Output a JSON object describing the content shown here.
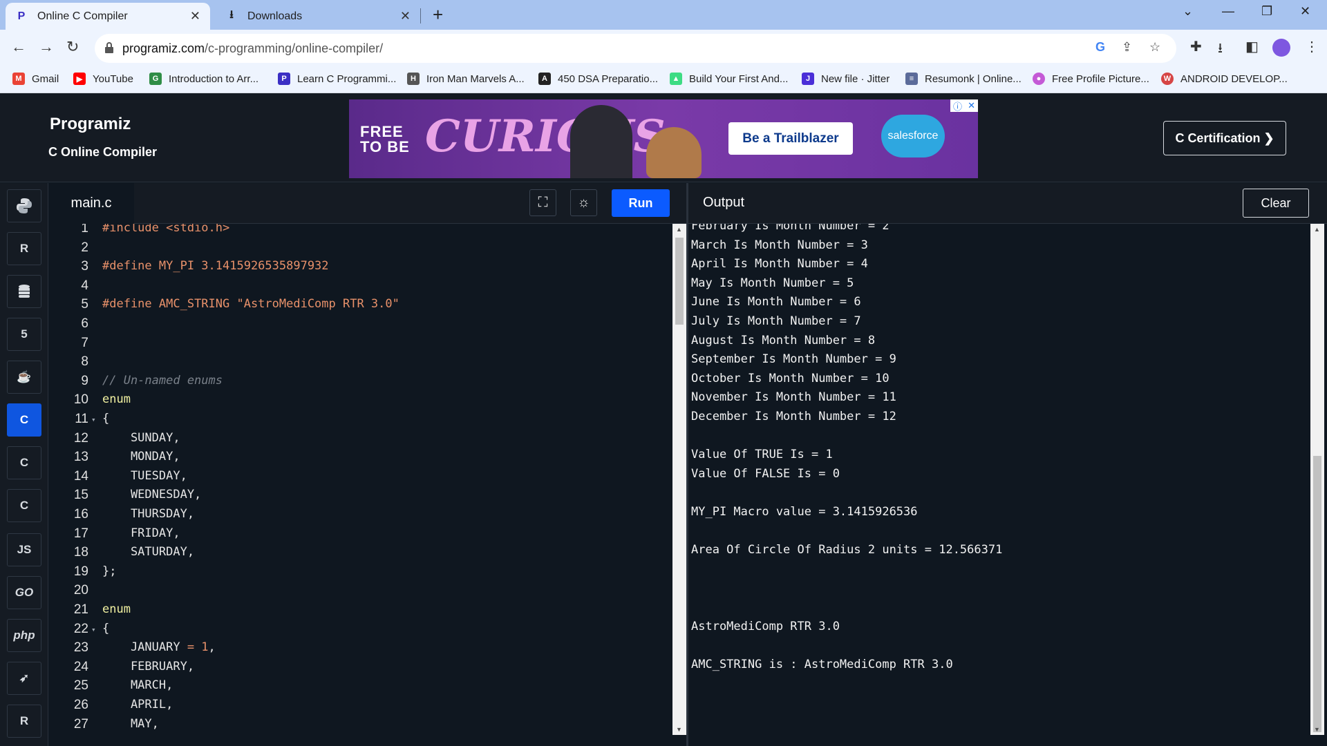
{
  "browser": {
    "tabs": [
      {
        "title": "Online C Compiler",
        "icon": "programiz-icon",
        "active": true
      },
      {
        "title": "Downloads",
        "icon": "download-icon",
        "active": false
      }
    ],
    "url_host": "programiz.com",
    "url_path": "/c-programming/online-compiler/",
    "bookmarks": [
      {
        "label": "Gmail",
        "icon": "gmail-icon",
        "color": "#ea4335"
      },
      {
        "label": "YouTube",
        "icon": "youtube-icon",
        "color": "#ff0000"
      },
      {
        "label": "Introduction to Arr...",
        "icon": "gfg-icon",
        "color": "#2f8d46"
      },
      {
        "label": "Learn C Programmi...",
        "icon": "programiz-icon",
        "color": "#3b2fc4"
      },
      {
        "label": "Iron Man Marvels A...",
        "icon": "hd-icon",
        "color": "#555555"
      },
      {
        "label": "450 DSA Preparatio...",
        "icon": "angular-icon",
        "color": "#222222"
      },
      {
        "label": "Build Your First And...",
        "icon": "android-icon",
        "color": "#3ddc84"
      },
      {
        "label": "New file · Jitter",
        "icon": "jitter-icon",
        "color": "#4b2fd8"
      },
      {
        "label": "Resumonk | Online...",
        "icon": "resume-icon",
        "color": "#5b6b9a"
      },
      {
        "label": "Free Profile Picture...",
        "icon": "profile-pic-icon",
        "color": "#c45ad6"
      },
      {
        "label": "ANDROID DEVELOP...",
        "icon": "android-dev-icon",
        "color": "#d64545"
      }
    ]
  },
  "site": {
    "brand": "Programiz",
    "subtitle": "C Online Compiler",
    "ad": {
      "free_line1": "FREE",
      "free_line2": "TO BE",
      "headline": "CURIOUS",
      "cta": "Be a Trailblazer",
      "sponsor": "salesforce"
    },
    "certification_button": "C Certification ❯"
  },
  "rail": [
    {
      "name": "python",
      "icon": "python-icon",
      "label": ""
    },
    {
      "name": "r",
      "icon": "r-icon",
      "label": "R"
    },
    {
      "name": "sql",
      "icon": "database-icon",
      "label": ""
    },
    {
      "name": "html",
      "icon": "html5-icon",
      "label": "5"
    },
    {
      "name": "java",
      "icon": "java-icon",
      "label": "☕"
    },
    {
      "name": "c",
      "icon": "c-icon",
      "label": "C",
      "active": true
    },
    {
      "name": "cpp",
      "icon": "cpp-icon",
      "label": "C"
    },
    {
      "name": "csharp",
      "icon": "csharp-icon",
      "label": "C"
    },
    {
      "name": "js",
      "icon": "js-icon",
      "label": "JS"
    },
    {
      "name": "go",
      "icon": "go-icon",
      "label": "GO"
    },
    {
      "name": "php",
      "icon": "php-icon",
      "label": "php"
    },
    {
      "name": "swift",
      "icon": "swift-icon",
      "label": "➶"
    },
    {
      "name": "rust",
      "icon": "rust-icon",
      "label": "R"
    }
  ],
  "editor": {
    "filename": "main.c",
    "run_label": "Run",
    "lines": [
      {
        "n": "1",
        "parts": [
          [
            "pp",
            "#include "
          ],
          [
            "str",
            "<stdio.h>"
          ]
        ]
      },
      {
        "n": "2",
        "parts": []
      },
      {
        "n": "3",
        "parts": [
          [
            "pp",
            "#define "
          ],
          [
            "str",
            "MY_PI 3.1415926535897932"
          ]
        ]
      },
      {
        "n": "4",
        "parts": []
      },
      {
        "n": "5",
        "parts": [
          [
            "pp",
            "#define "
          ],
          [
            "str",
            "AMC_STRING \"AstroMediComp RTR 3.0\""
          ]
        ]
      },
      {
        "n": "6",
        "parts": []
      },
      {
        "n": "7",
        "parts": []
      },
      {
        "n": "8",
        "parts": []
      },
      {
        "n": "9",
        "parts": [
          [
            "cm",
            "// Un-named enums"
          ]
        ]
      },
      {
        "n": "10",
        "parts": [
          [
            "kw",
            "enum"
          ]
        ]
      },
      {
        "n": "11",
        "fold": true,
        "parts": [
          [
            "tx",
            "{"
          ]
        ]
      },
      {
        "n": "12",
        "parts": [
          [
            "tx",
            "    SUNDAY,"
          ]
        ]
      },
      {
        "n": "13",
        "parts": [
          [
            "tx",
            "    MONDAY,"
          ]
        ]
      },
      {
        "n": "14",
        "parts": [
          [
            "tx",
            "    TUESDAY,"
          ]
        ]
      },
      {
        "n": "15",
        "parts": [
          [
            "tx",
            "    WEDNESDAY,"
          ]
        ]
      },
      {
        "n": "16",
        "parts": [
          [
            "tx",
            "    THURSDAY,"
          ]
        ]
      },
      {
        "n": "17",
        "parts": [
          [
            "tx",
            "    FRIDAY,"
          ]
        ]
      },
      {
        "n": "18",
        "parts": [
          [
            "tx",
            "    SATURDAY,"
          ]
        ]
      },
      {
        "n": "19",
        "parts": [
          [
            "tx",
            "};"
          ]
        ]
      },
      {
        "n": "20",
        "parts": []
      },
      {
        "n": "21",
        "parts": [
          [
            "kw",
            "enum"
          ]
        ]
      },
      {
        "n": "22",
        "fold": true,
        "parts": [
          [
            "tx",
            "{"
          ]
        ]
      },
      {
        "n": "23",
        "parts": [
          [
            "tx",
            "    JANUARY "
          ],
          [
            "num",
            "= 1"
          ],
          [
            "tx",
            ","
          ]
        ]
      },
      {
        "n": "24",
        "parts": [
          [
            "tx",
            "    FEBRUARY,"
          ]
        ]
      },
      {
        "n": "25",
        "parts": [
          [
            "tx",
            "    MARCH,"
          ]
        ]
      },
      {
        "n": "26",
        "parts": [
          [
            "tx",
            "    APRIL,"
          ]
        ]
      },
      {
        "n": "27",
        "parts": [
          [
            "tx",
            "    MAY,"
          ]
        ]
      }
    ]
  },
  "output": {
    "title": "Output",
    "clear_label": "Clear",
    "lines": [
      "February Is Month Number = 2",
      "March Is Month Number = 3",
      "April Is Month Number = 4",
      "May Is Month Number = 5",
      "June Is Month Number = 6",
      "July Is Month Number = 7",
      "August Is Month Number = 8",
      "September Is Month Number = 9",
      "October Is Month Number = 10",
      "November Is Month Number = 11",
      "December Is Month Number = 12",
      "",
      "Value Of TRUE Is = 1",
      "Value Of FALSE Is = 0",
      "",
      "MY_PI Macro value = 3.1415926536",
      "",
      "Area Of Circle Of Radius 2 units = 12.566371",
      "",
      "",
      "",
      "AstroMediComp RTR 3.0",
      "",
      "AMC_STRING is : AstroMediComp RTR 3.0"
    ]
  }
}
